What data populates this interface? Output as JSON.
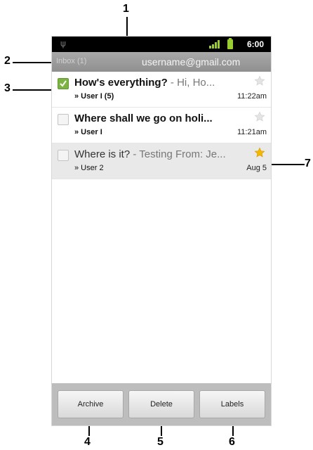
{
  "status_bar": {
    "time": "6:00",
    "icons": [
      "usb-icon",
      "signal-icon",
      "battery-icon"
    ]
  },
  "title_bar": {
    "folder": "Inbox (1)",
    "account": "username@gmail.com"
  },
  "messages": [
    {
      "subject": "How's everything?",
      "snippet": " - Hi, Ho...",
      "sender": "» User I (5)",
      "time": "11:22am",
      "checked": true,
      "starred": false,
      "read": false
    },
    {
      "subject": "Where shall we go on holi...",
      "snippet": "",
      "sender": "» User I",
      "time": "11:21am",
      "checked": false,
      "starred": false,
      "read": false
    },
    {
      "subject": "Where is it?",
      "snippet": " - Testing From: Je...",
      "sender": "» User 2",
      "time": "Aug 5",
      "checked": false,
      "starred": true,
      "read": true
    }
  ],
  "actions": {
    "archive": "Archive",
    "delete": "Delete",
    "labels": "Labels"
  },
  "callouts": {
    "c1": "1",
    "c2": "2",
    "c3": "3",
    "c4": "4",
    "c5": "5",
    "c6": "6",
    "c7": "7"
  },
  "colors": {
    "checkbox_checked": "#7cb342",
    "star_active": "#f5b800",
    "star_inactive": "#d0d0d0",
    "title_bar": "#9a9a9a"
  }
}
